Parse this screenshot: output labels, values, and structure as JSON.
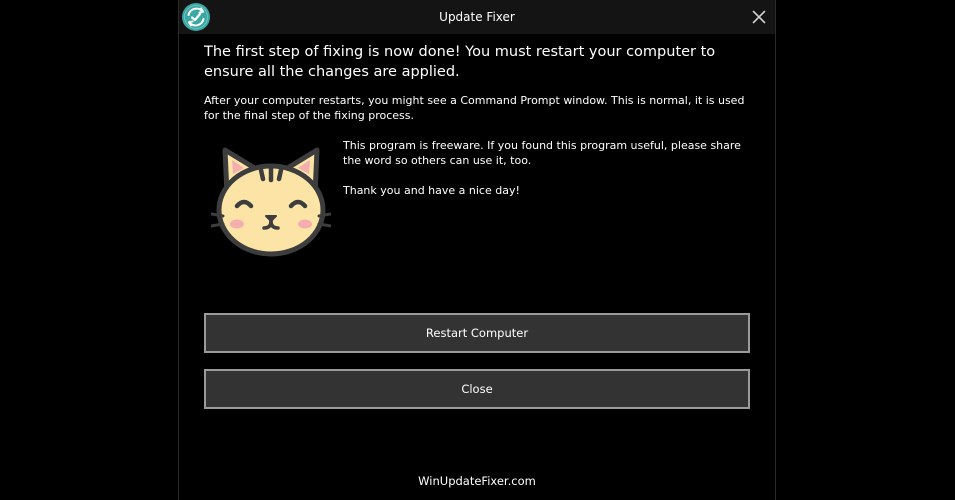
{
  "window": {
    "title": "Update Fixer",
    "icon": "refresh-check-logo-icon",
    "close_icon": "close-icon"
  },
  "content": {
    "headline": "The first step of fixing is now done! You must restart your computer to ensure all the changes are applied.",
    "note": "After your computer restarts, you might see a Command Prompt window. This is normal, it is used for the final step of the fixing process.",
    "freeware": "This program is freeware. If you found this program useful, please share the word so others can use it, too.",
    "thanks": "Thank you and have a nice day!",
    "illustration": "cat-face-icon"
  },
  "buttons": {
    "restart_label": "Restart Computer",
    "close_label": "Close"
  },
  "footer": {
    "link_text": "WinUpdateFixer.com"
  },
  "colors": {
    "background": "#000000",
    "titlebar": "#141414",
    "button_bg": "#333333",
    "button_border": "#9a9a9a",
    "logo_teal": "#3aa8a4",
    "cat_fill": "#fbe4a6",
    "cat_outline": "#3d3d3d",
    "cat_blush": "#f4aeb0"
  }
}
